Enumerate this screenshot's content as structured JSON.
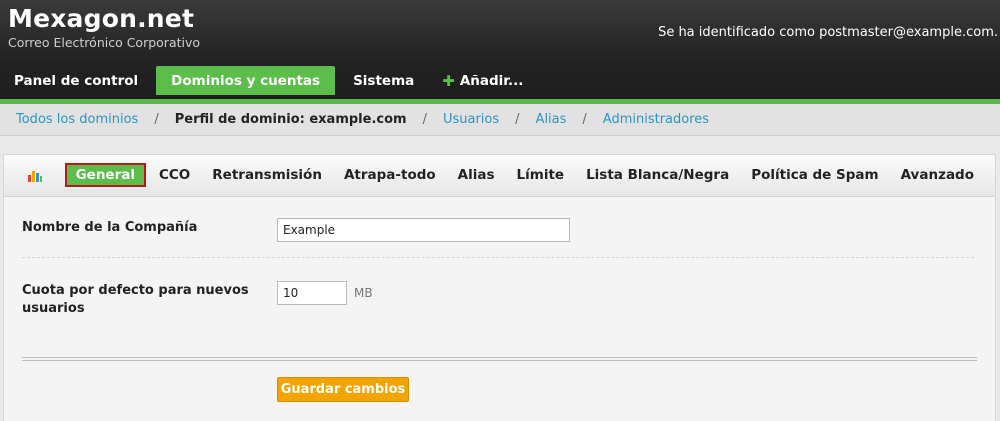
{
  "header": {
    "brand_title": "Mexagon.net",
    "brand_subtitle": "Correo Electrónico Corporativo",
    "user_info": "Se ha identificado como postmaster@example.com."
  },
  "topnav": {
    "items": [
      {
        "label": "Panel de control",
        "active": false
      },
      {
        "label": "Dominios y cuentas",
        "active": true
      },
      {
        "label": "Sistema",
        "active": false
      },
      {
        "label": "Añadir...",
        "active": false,
        "icon": "plus-icon"
      }
    ]
  },
  "breadcrumb": {
    "items": [
      {
        "label": "Todos los dominios",
        "link": true
      },
      {
        "label": "Perfil de dominio: example.com",
        "link": false
      },
      {
        "label": "Usuarios",
        "link": true
      },
      {
        "label": "Alias",
        "link": true
      },
      {
        "label": "Administradores",
        "link": true
      }
    ],
    "separator": "/"
  },
  "tabs": {
    "icon": "bar-chart-icon",
    "items": [
      {
        "label": "General",
        "active": true
      },
      {
        "label": "CCO"
      },
      {
        "label": "Retransmisión"
      },
      {
        "label": "Atrapa-todo"
      },
      {
        "label": "Alias"
      },
      {
        "label": "Límite"
      },
      {
        "label": "Lista Blanca/Negra"
      },
      {
        "label": "Política de Spam"
      },
      {
        "label": "Avanzado"
      }
    ]
  },
  "form": {
    "company_label": "Nombre de la Compañía",
    "company_value": "Example",
    "quota_label": "Cuota por defecto para nuevos usuarios",
    "quota_value": "10",
    "quota_unit": "MB",
    "save_label": "Guardar cambios"
  },
  "colors": {
    "accent_green": "#5cbd4a",
    "link_blue": "#2a95c4",
    "button_orange": "#f2a400",
    "active_tab_border": "#b11b1b"
  }
}
